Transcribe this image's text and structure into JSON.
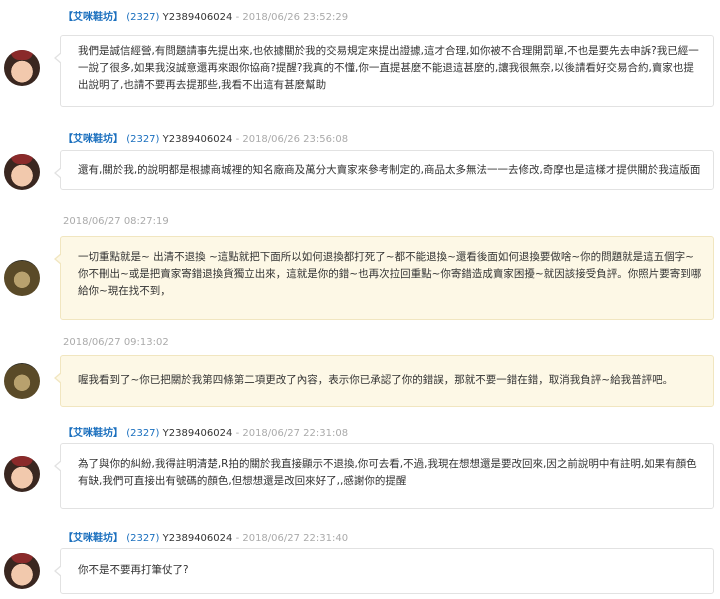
{
  "messages": [
    {
      "shop_name": "【艾咪鞋坊】",
      "count": "(2327)",
      "user_id": "Y2389406024",
      "timestamp": "- 2018/06/26 23:52:29",
      "text": "我們是誠信經營,有問題請事先提出來,也依據關於我的交易規定來提出證據,這才合理,如你被不合理開罰單,不也是要先去申訴?我已經一一說了很多,如果我沒誠意還再來跟你協商?提醒?我真的不懂,你一直提甚麼不能退這甚麼的,讓我很無奈,以後請看好交易合約,賣家也提出說明了,也請不要再去提那些,我看不出這有甚麼幫助"
    },
    {
      "shop_name": "【艾咪鞋坊】",
      "count": "(2327)",
      "user_id": "Y2389406024",
      "timestamp": "- 2018/06/26 23:56:08",
      "text": "還有,關於我,的說明都是根據商城裡的知名廠商及萬分大賣家來參考制定的,商品太多無法一一去修改,奇摩也是這樣才提供關於我這版面"
    },
    {
      "timestamp": "2018/06/27 08:27:19",
      "text": "一切重點就是~ 出清不退換 ~這點就把下面所以如何退換都打死了~都不能退換~還看後面如何退換要做啥~你的問題就是這五個字~你不刪出~或是把賣家寄錯退換貨獨立出來，這就是你的錯~也再次拉回重點~你寄錯造成賣家困擾~就因該接受負評。你照片要寄到哪給你~現在找不到，"
    },
    {
      "timestamp": "2018/06/27 09:13:02",
      "text": "喔我看到了~你已把關於我第四條第二項更改了內容，表示你已承認了你的錯誤，那就不要一錯在錯，取消我負評~給我普評吧。"
    },
    {
      "shop_name": "【艾咪鞋坊】",
      "count": "(2327)",
      "user_id": "Y2389406024",
      "timestamp": "- 2018/06/27 22:31:08",
      "text": "為了與你的糾紛,我得註明清楚,R拍的關於我直接顯示不退換,你可去看,不過,我現在想想還是要改回來,因之前說明中有註明,如果有顏色有缺,我們可直接出有號碼的顏色,但想想還是改回來好了,,感謝你的提醒"
    },
    {
      "shop_name": "【艾咪鞋坊】",
      "count": "(2327)",
      "user_id": "Y2389406024",
      "timestamp": "- 2018/06/27 22:31:40",
      "text": "你不是不要再打筆仗了?"
    }
  ]
}
